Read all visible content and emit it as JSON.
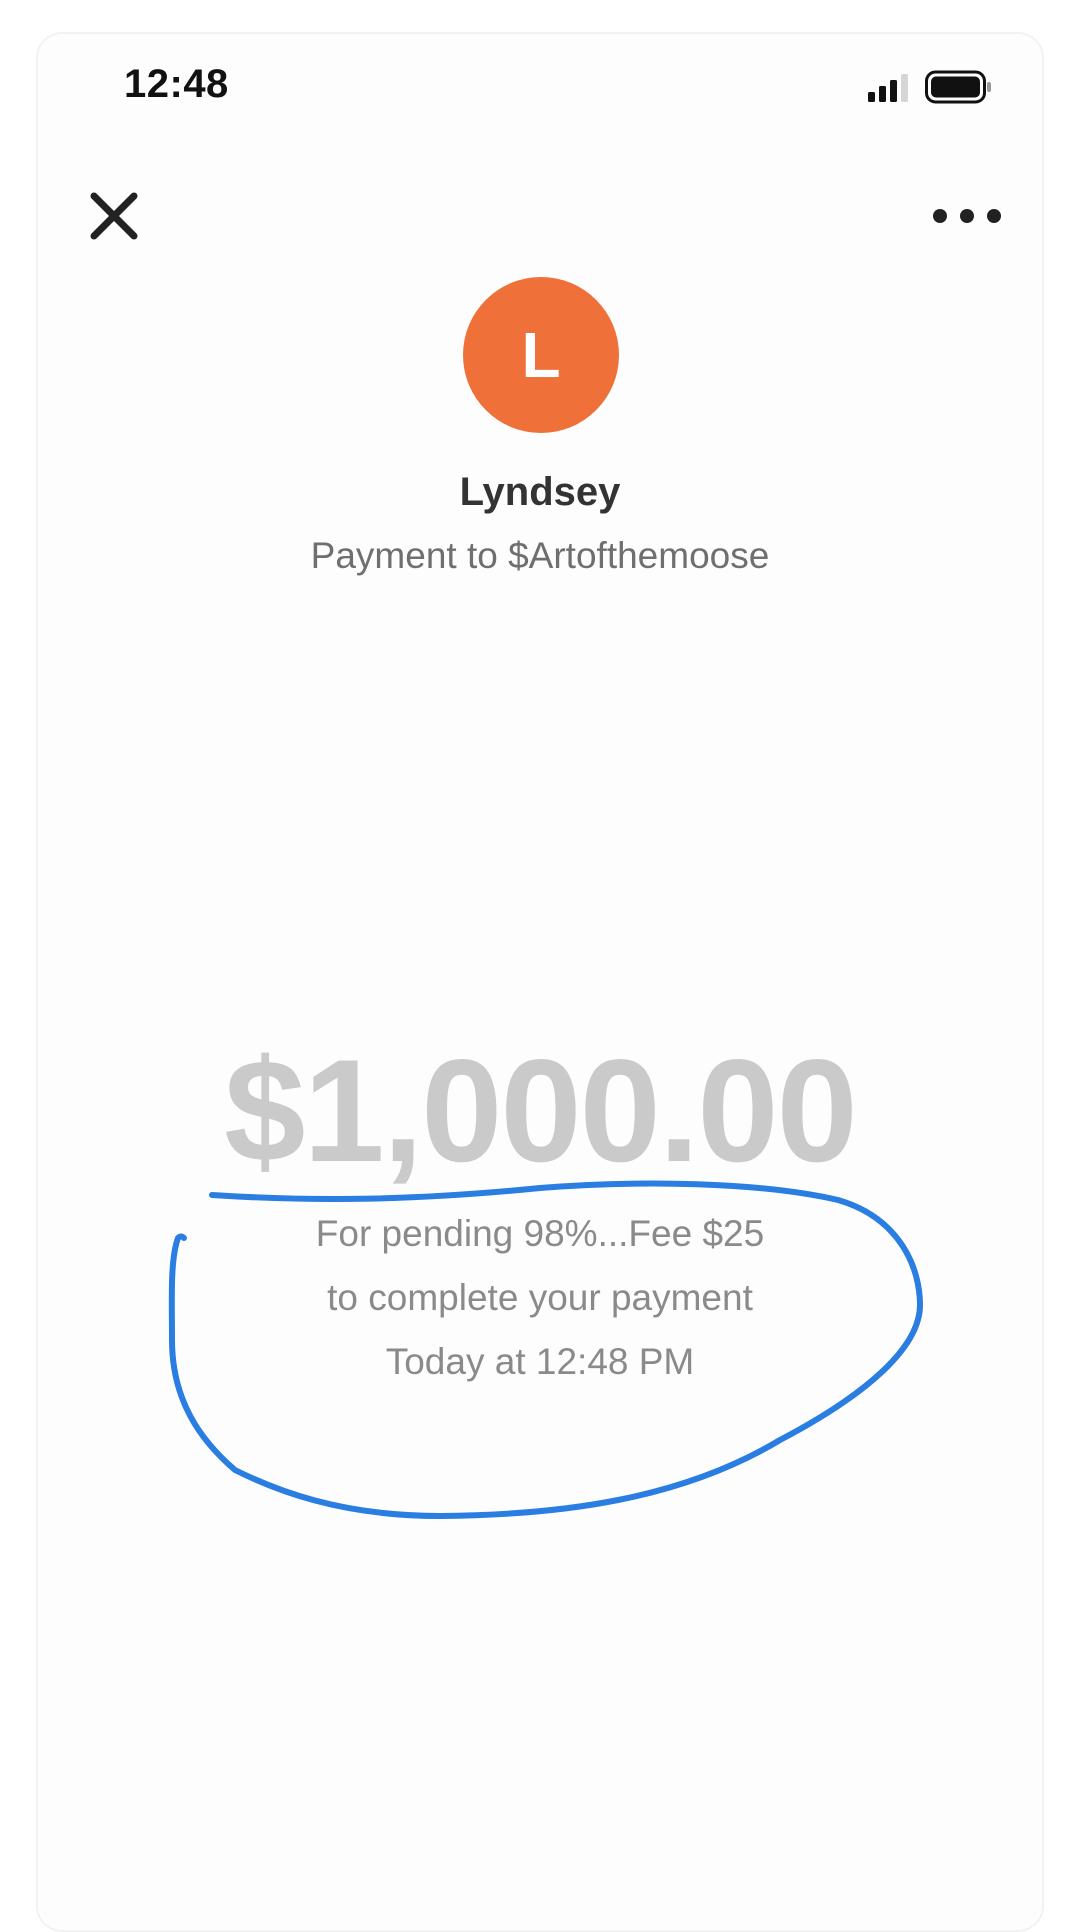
{
  "status_bar": {
    "time": "12:48"
  },
  "header": {
    "close_icon": "close-icon",
    "more_icon": "more-horizontal-icon"
  },
  "recipient": {
    "avatar_initial": "L",
    "avatar_color": "#f0703a",
    "name": "Lyndsey",
    "subtitle": "Payment to $Artofthemoose"
  },
  "payment": {
    "amount": "$1,000.00",
    "note_line_1": "For pending 98%...Fee $25",
    "note_line_2": "to complete your payment",
    "timestamp": "Today at 12:48 PM"
  },
  "annotation": {
    "color": "#2a7de1"
  }
}
